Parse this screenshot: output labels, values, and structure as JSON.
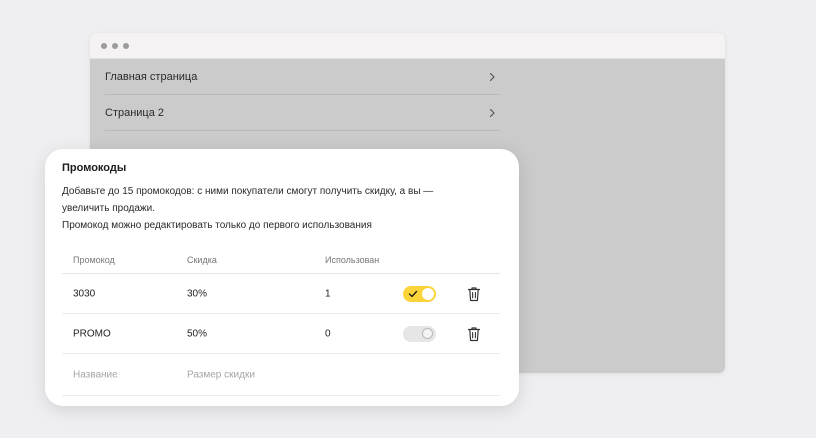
{
  "nav": {
    "items": [
      {
        "label": "Главная страница"
      },
      {
        "label": "Страница 2"
      }
    ]
  },
  "promo": {
    "title": "Промокоды",
    "description_lines": [
      "Добавьте до 15 промокодов: с ними покупатели смогут получить скидку, а вы —",
      "увеличить продажи.",
      "Промокод можно редактировать только до первого использования"
    ],
    "columns": {
      "code": "Промокод",
      "discount": "Скидка",
      "used": "Использован"
    },
    "rows": [
      {
        "code": "3030",
        "discount": "30%",
        "used": "1",
        "enabled": true
      },
      {
        "code": "PROMO",
        "discount": "50%",
        "used": "0",
        "enabled": false
      }
    ],
    "new_row": {
      "name_placeholder": "Название",
      "discount_placeholder": "Размер скидки"
    }
  },
  "colors": {
    "accent": "#fbd43a",
    "backdrop": "#cbcbcb"
  },
  "icons": {
    "nav_chevron": "chevron-right-icon",
    "delete": "trash-icon",
    "toggle_check": "check-icon"
  }
}
